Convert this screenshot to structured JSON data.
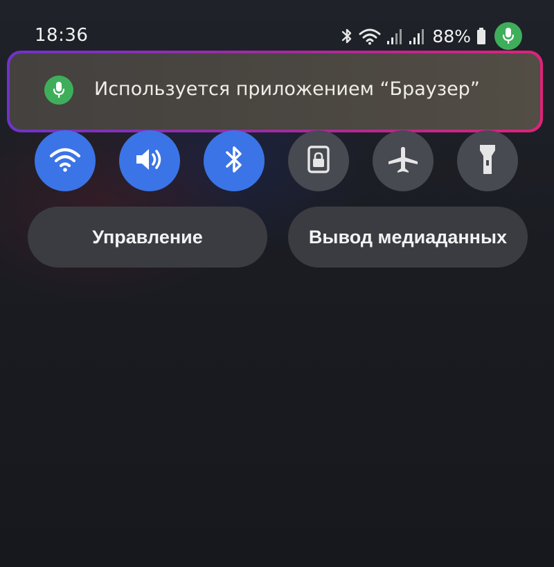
{
  "status_bar": {
    "time": "18:36",
    "battery_percent": "88%",
    "icons": [
      "bluetooth-icon",
      "wifi-icon",
      "signal-icon",
      "signal-icon",
      "battery-icon",
      "microphone-icon"
    ]
  },
  "privacy_banner": {
    "icon": "microphone-icon",
    "text": "Используется приложением “Браузер”",
    "highlight_colors": [
      "#6f33c9",
      "#e0227a"
    ],
    "icon_color": "#3fae5b"
  },
  "quick_toggles": [
    {
      "id": "wifi",
      "icon": "wifi-icon",
      "state": "on"
    },
    {
      "id": "sound",
      "icon": "sound-icon",
      "state": "on"
    },
    {
      "id": "bluetooth",
      "icon": "bluetooth-icon",
      "state": "on"
    },
    {
      "id": "rotation-lock",
      "icon": "lock-icon",
      "state": "off"
    },
    {
      "id": "airplane",
      "icon": "airplane-icon",
      "state": "off"
    },
    {
      "id": "flashlight",
      "icon": "flashlight-icon",
      "state": "off"
    }
  ],
  "buttons": {
    "control_label": "Управление",
    "media_output_label": "Вывод медиаданных"
  },
  "colors": {
    "toggle_on": "#3b74e6",
    "toggle_off": "#474a50"
  }
}
